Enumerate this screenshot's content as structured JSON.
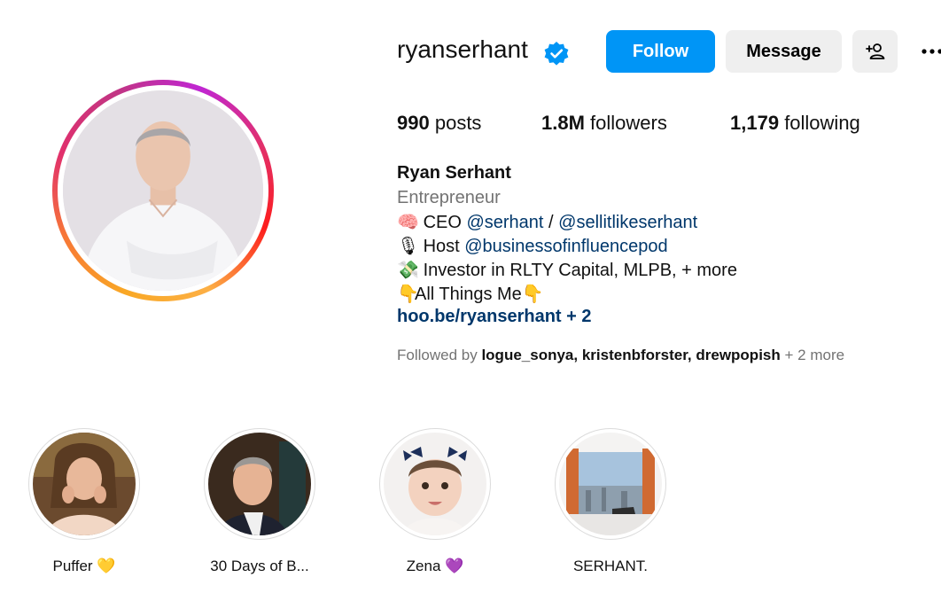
{
  "profile": {
    "username": "ryanserhant",
    "verified": true
  },
  "actions": {
    "follow": "Follow",
    "message": "Message"
  },
  "stats": {
    "posts_count": "990",
    "posts_label": "posts",
    "followers_count": "1.8M",
    "followers_label": "followers",
    "following_count": "1,179",
    "following_label": "following"
  },
  "bio": {
    "name": "Ryan Serhant",
    "category": "Entrepreneur",
    "line1_prefix": "CEO",
    "line1_link1": "@serhant",
    "line1_sep": "/",
    "line1_link2": "@sellitlikeserhant",
    "line2_prefix": "Host",
    "line2_link": "@businessofinfluencepod",
    "line3": "Investor in RLTY Capital, MLPB, + more",
    "line4": "All Things Me",
    "url": "hoo.be/ryanserhant",
    "url_more": "+ 2"
  },
  "followed_by": {
    "prefix": "Followed by",
    "users": [
      "logue_sonya",
      "kristenbforster",
      "drewpopish"
    ],
    "more": "+ 2 more"
  },
  "highlights": [
    {
      "label": "Puffer 💛"
    },
    {
      "label": "30 Days of B..."
    },
    {
      "label": "Zena 💜"
    },
    {
      "label": "SERHANT."
    }
  ],
  "colors": {
    "primary": "#0095f6",
    "link": "#00376b",
    "secondary_text": "#737373",
    "button_bg": "#efefef"
  },
  "icons": [
    "verified-badge-icon",
    "add-user-icon",
    "more-options-icon",
    "brain-emoji",
    "microphone-emoji",
    "money-emoji",
    "pointing-down-emoji"
  ]
}
